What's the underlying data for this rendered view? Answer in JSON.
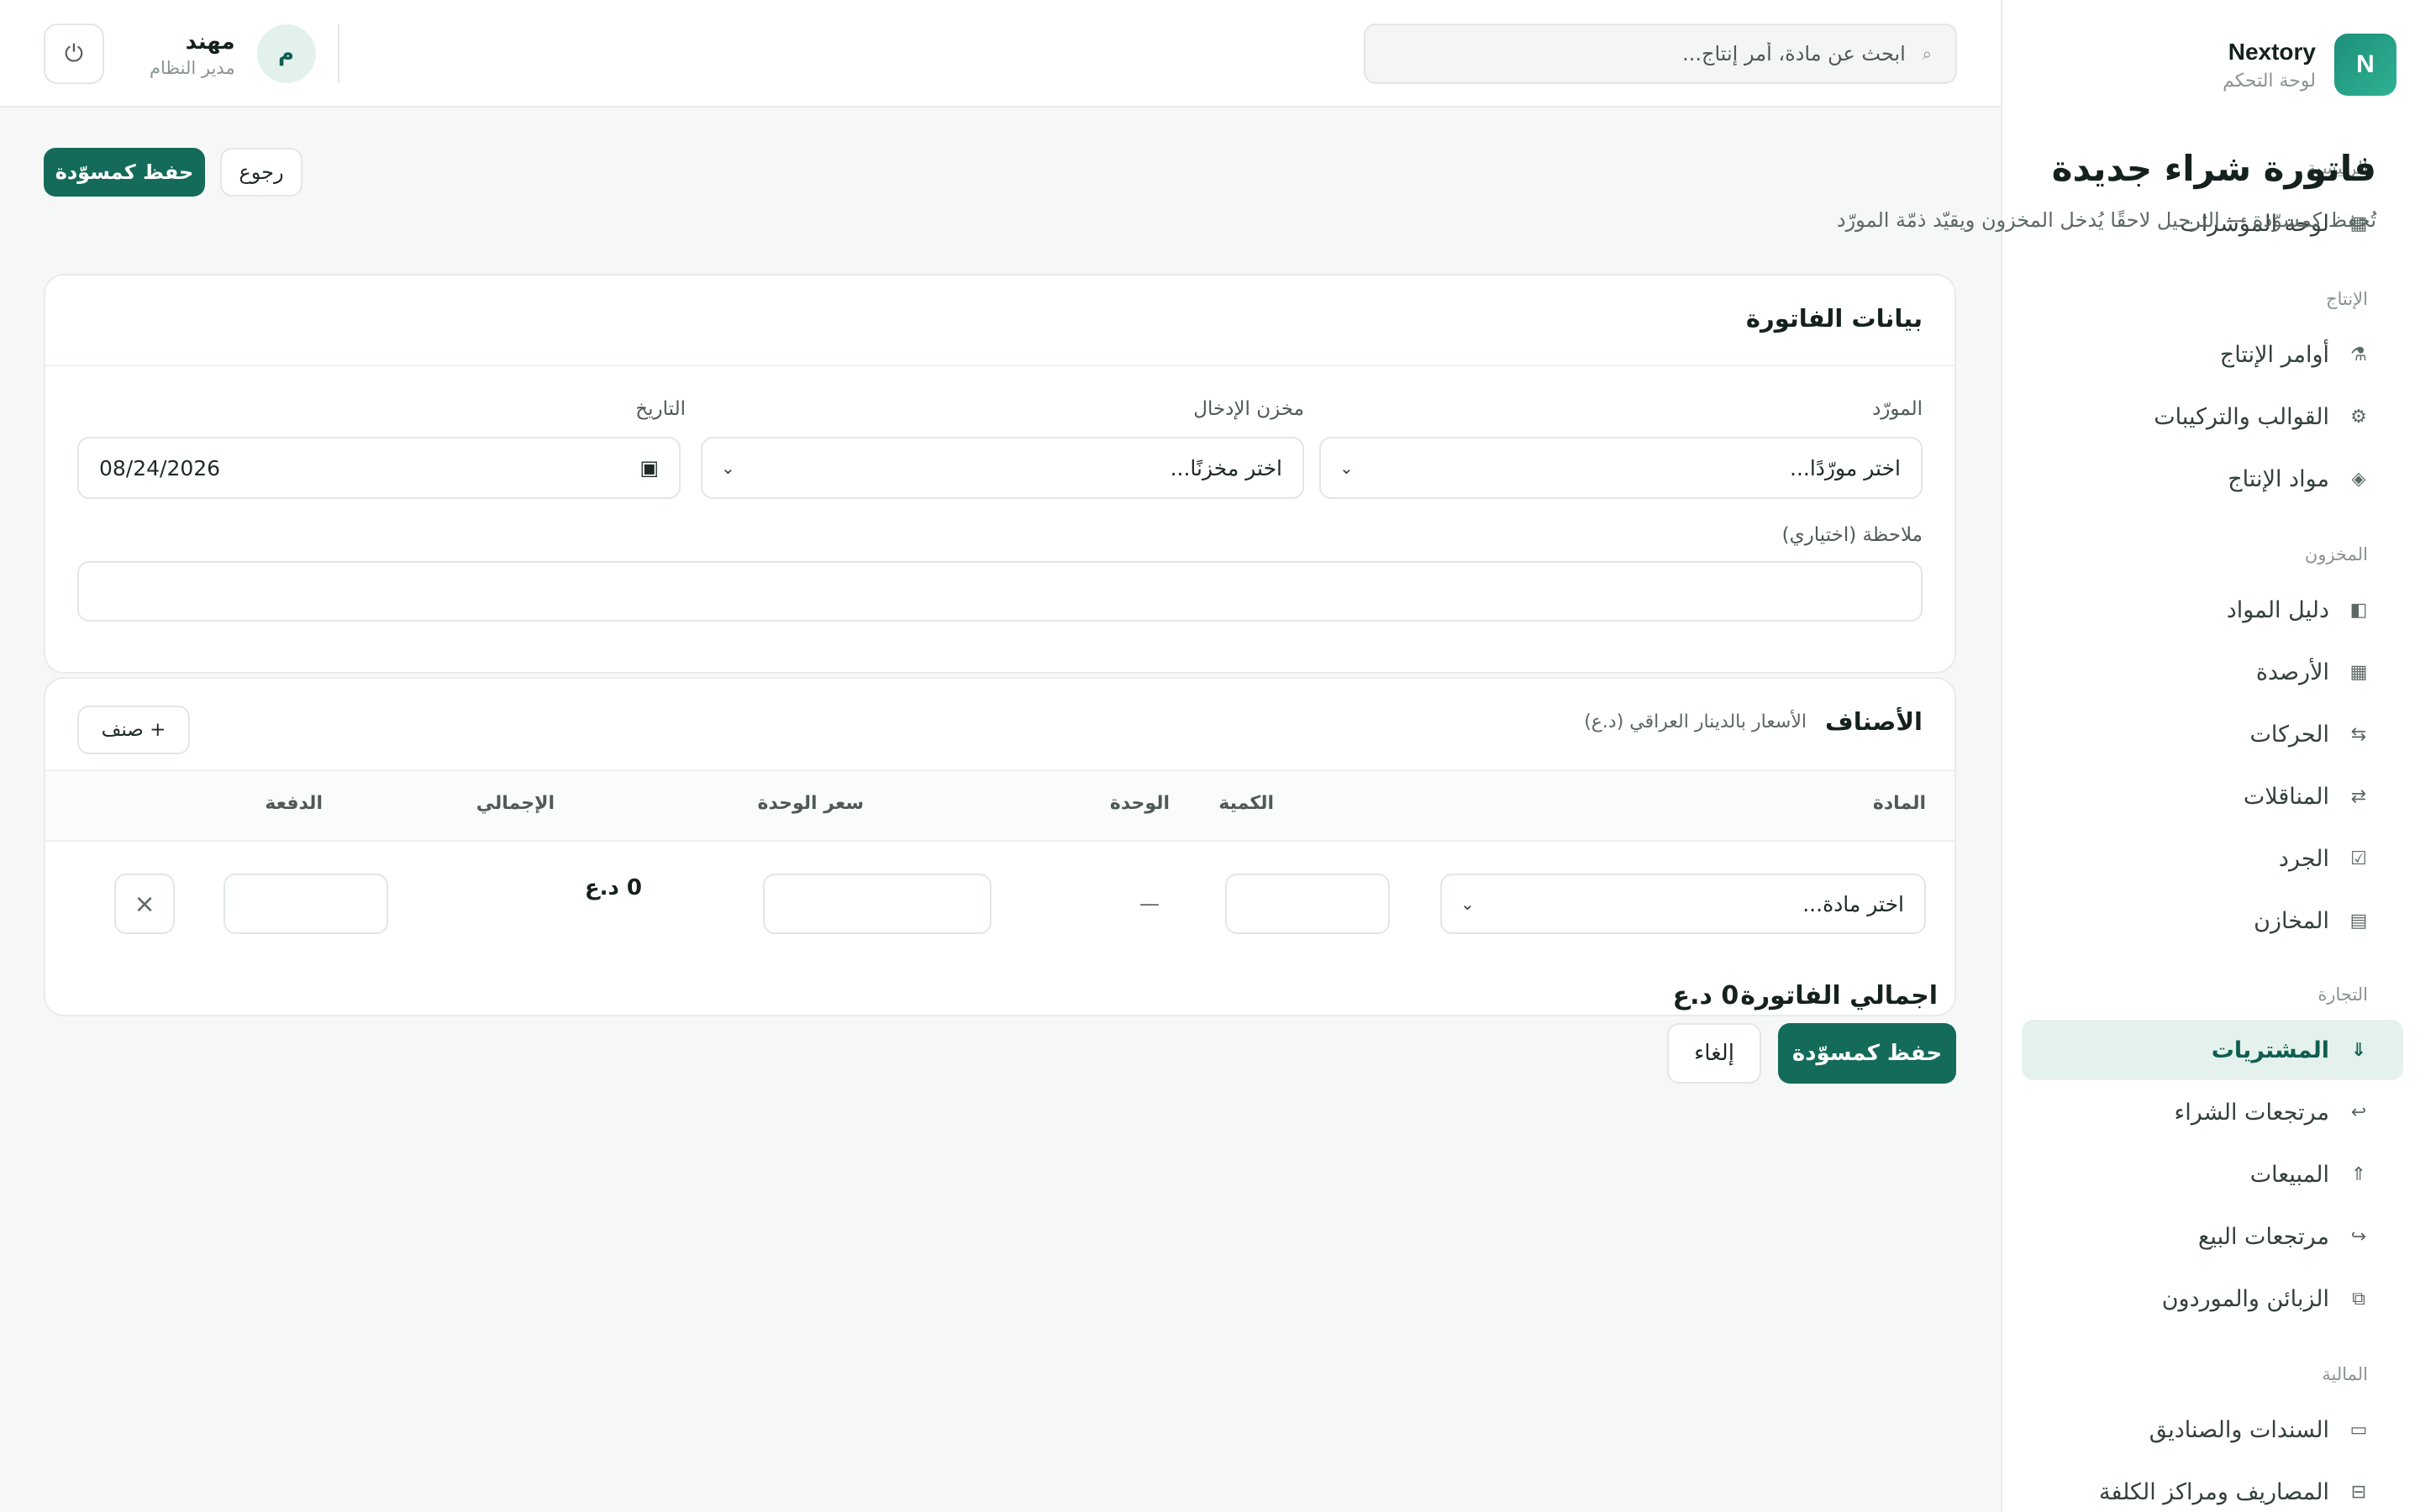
{
  "brand": {
    "logo_letter": "N",
    "name": "Nextory",
    "subtitle": "لوحة التحكم"
  },
  "sidebar": {
    "sections": [
      {
        "label": "الرئيسية"
      },
      {
        "label": "الإنتاج"
      },
      {
        "label": "المخزون"
      },
      {
        "label": "التجارة"
      },
      {
        "label": "المالية"
      }
    ],
    "items": [
      {
        "label": "لوحة المؤشرات",
        "icon": "▦",
        "icon_name": "dashboard-icon"
      },
      {
        "label": "أوامر الإنتاج",
        "icon": "⚗",
        "icon_name": "production-orders-icon"
      },
      {
        "label": "القوالب والتركيبات",
        "icon": "⚙",
        "icon_name": "templates-icon"
      },
      {
        "label": "مواد الإنتاج",
        "icon": "◈",
        "icon_name": "production-materials-icon"
      },
      {
        "label": "دليل المواد",
        "icon": "◧",
        "icon_name": "materials-guide-icon"
      },
      {
        "label": "الأرصدة",
        "icon": "▦",
        "icon_name": "balances-icon"
      },
      {
        "label": "الحركات",
        "icon": "⇆",
        "icon_name": "movements-icon"
      },
      {
        "label": "المناقلات",
        "icon": "⇄",
        "icon_name": "transfers-icon"
      },
      {
        "label": "الجرد",
        "icon": "☑",
        "icon_name": "stocktake-icon"
      },
      {
        "label": "المخازن",
        "icon": "▤",
        "icon_name": "warehouses-icon"
      },
      {
        "label": "المشتريات",
        "icon": "⇓",
        "icon_name": "purchases-icon",
        "active": true
      },
      {
        "label": "مرتجعات الشراء",
        "icon": "↩",
        "icon_name": "purchase-returns-icon"
      },
      {
        "label": "المبيعات",
        "icon": "⇑",
        "icon_name": "sales-icon"
      },
      {
        "label": "مرتجعات البيع",
        "icon": "↪",
        "icon_name": "sales-returns-icon"
      },
      {
        "label": "الزبائن والموردون",
        "icon": "⧉",
        "icon_name": "customers-suppliers-icon"
      },
      {
        "label": "السندات والصناديق",
        "icon": "▭",
        "icon_name": "vouchers-icon"
      },
      {
        "label": "المصاريف ومراكز الكلفة",
        "icon": "⊟",
        "icon_name": "expenses-icon"
      }
    ]
  },
  "topbar": {
    "search_placeholder": "ابحث عن مادة، أمر إنتاج...",
    "user_name": "مهند",
    "user_role": "مدير النظام",
    "avatar_letter": "م"
  },
  "page": {
    "title": "فاتورة شراء جديدة",
    "subtitle": "تُحفظ كمسوّدة — الترحيل لاحقًا يُدخل المخزون ويقيّد ذمّة المورّد",
    "save_draft": "حفظ كمسوّدة",
    "back": "رجوع"
  },
  "invoice": {
    "title": "بيانات الفاتورة",
    "supplier_label": "المورّد",
    "supplier_value": "اختر مورّدًا...",
    "warehouse_label": "مخزن الإدخال",
    "warehouse_value": "اختر مخزنًا...",
    "date_label": "التاريخ",
    "date_value": "08/24/2026",
    "note_label": "ملاحظة (اختياري)",
    "note_value": ""
  },
  "items": {
    "title": "الأصناف",
    "currency_note": "الأسعار بالدينار العراقي (د.ع)",
    "add_button": "+ صنف",
    "columns": [
      "المادة",
      "الكمية",
      "الوحدة",
      "سعر الوحدة",
      "الإجمالي",
      "الدفعة"
    ],
    "rows": [
      {
        "material": "اختر مادة...",
        "quantity": "",
        "unit": "—",
        "unit_price": "",
        "total": "0 د.ع",
        "batch": ""
      }
    ],
    "grand_total_label": "اجمالي الفاتورة",
    "grand_total_value": "0 د.ع"
  },
  "footer": {
    "save_draft": "حفظ كمسوّدة",
    "cancel": "إلغاء"
  },
  "colors": {
    "primary": "#146b5a",
    "active_bg": "#e5f1ed",
    "brand_gradient_start": "#1d8f78"
  }
}
